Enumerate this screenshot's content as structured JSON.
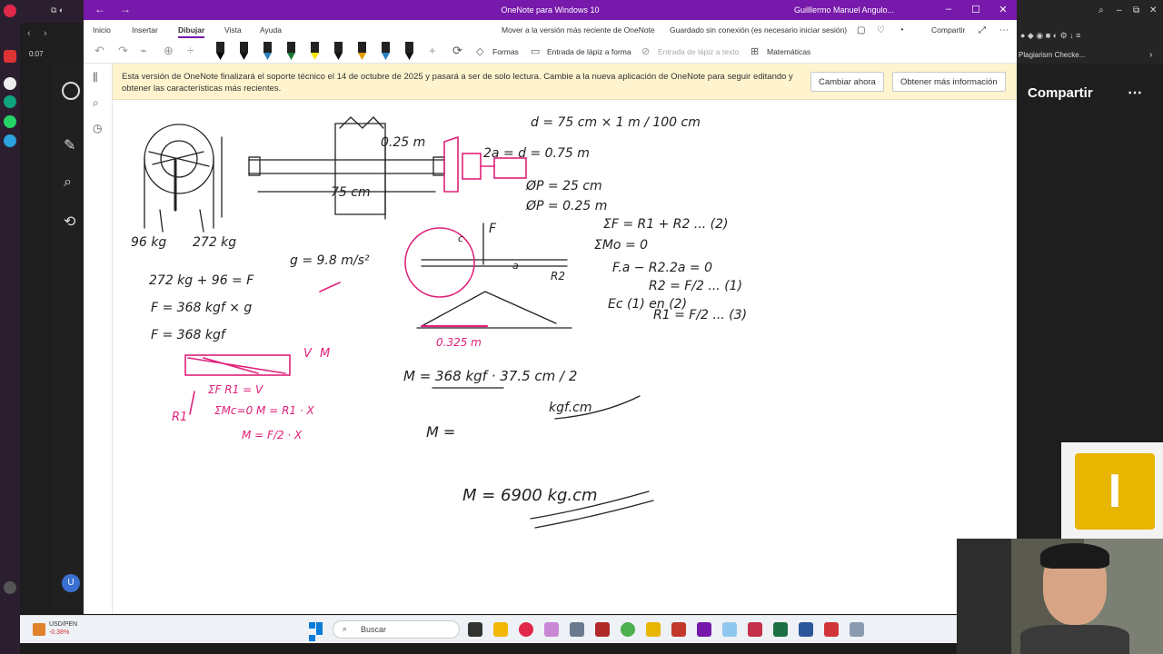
{
  "window": {
    "title": "OneNote para Windows 10",
    "user": "Guilllermo Manuel Angulo..."
  },
  "ribbon": {
    "tabs": [
      "Inicio",
      "Insertar",
      "Dibujar",
      "Vista",
      "Ayuda"
    ],
    "active_tab": "Dibujar",
    "move_link": "Mover a la versión más reciente de OneNote",
    "saved_status": "Guardado sin conexión (es necesario iniciar sesión)",
    "share_label": "Compartir"
  },
  "toolbar": {
    "shapes": "Formas",
    "ink_to_shape": "Entrada de lápiz a forma",
    "ink_to_text": "Entrada de lápiz a texto",
    "math": "Matemáticas",
    "pens": [
      {
        "color": "#000000"
      },
      {
        "color": "#111111"
      },
      {
        "color": "#2a7fbf"
      },
      {
        "color": "#1b7a3a"
      },
      {
        "color": "#f3e600"
      },
      {
        "color": "#111111"
      },
      {
        "color": "#e39b00"
      },
      {
        "color": "#2a7fbf"
      },
      {
        "color": "#111111"
      }
    ]
  },
  "notice": {
    "message": "Esta versión de OneNote finalizará el soporte técnico el 14 de octubre de 2025 y pasará a ser de solo lectura. Cambie a la nueva aplicación de OneNote para seguir editando y obtener las características más recientes.",
    "change_now": "Cambiar ahora",
    "more_info": "Obtener más información"
  },
  "ink_notes": {
    "d_eq": "d = 75 cm × 1 m / 100 cm",
    "two_a": "2a = d = 0.75 m",
    "phi_25": "ØP = 25 cm",
    "phi_025": "ØP = 0.25 m",
    "sum_f": "ΣF = R1 + R2 ... (2)",
    "sum_m": "ΣMo = 0",
    "f_eq": "F.a − R2.2a = 0",
    "r2": "R2 = F/2 ... (1)",
    "ec": "Ec (1) en (2)",
    "r1": "R1 = F/2 ... (3)",
    "kg96": "96 kg",
    "kg272": "272 kg",
    "sum_kg": "272 kg + 96 = F",
    "g": "g = 9.8 m/s²",
    "f368": "F = 368 kgf × g",
    "f368b": "F = 368 kgf",
    "dim25": "0.25 m",
    "dim75": "75 cm",
    "dim0325": "0.325 m",
    "m_eq": "M = 368 kgf · 37.5 cm / 2",
    "kgf_cm": "kgf.cm",
    "m_partial": "M =",
    "m_result": "M = 6900 kg.cm",
    "pink_block": "ΣF  R1 = V",
    "pink_m": "ΣMc=0  M = R1 · X",
    "pink_m2": "M = F/2 · X",
    "label_m": "M",
    "label_v": "V",
    "label_r1": "R1",
    "label_r2": "R2",
    "label_f": "F",
    "label_c": "c",
    "label_a": "a"
  },
  "right_panel": {
    "share": "Compartir",
    "plagiarism": "Plagiarism Checke...",
    "tile_letter": "I"
  },
  "taskbar": {
    "ticker_label": "USD/PEN",
    "ticker_value": "-0.38%",
    "search_placeholder": "Buscar"
  },
  "opera": {
    "time": "0:07"
  }
}
